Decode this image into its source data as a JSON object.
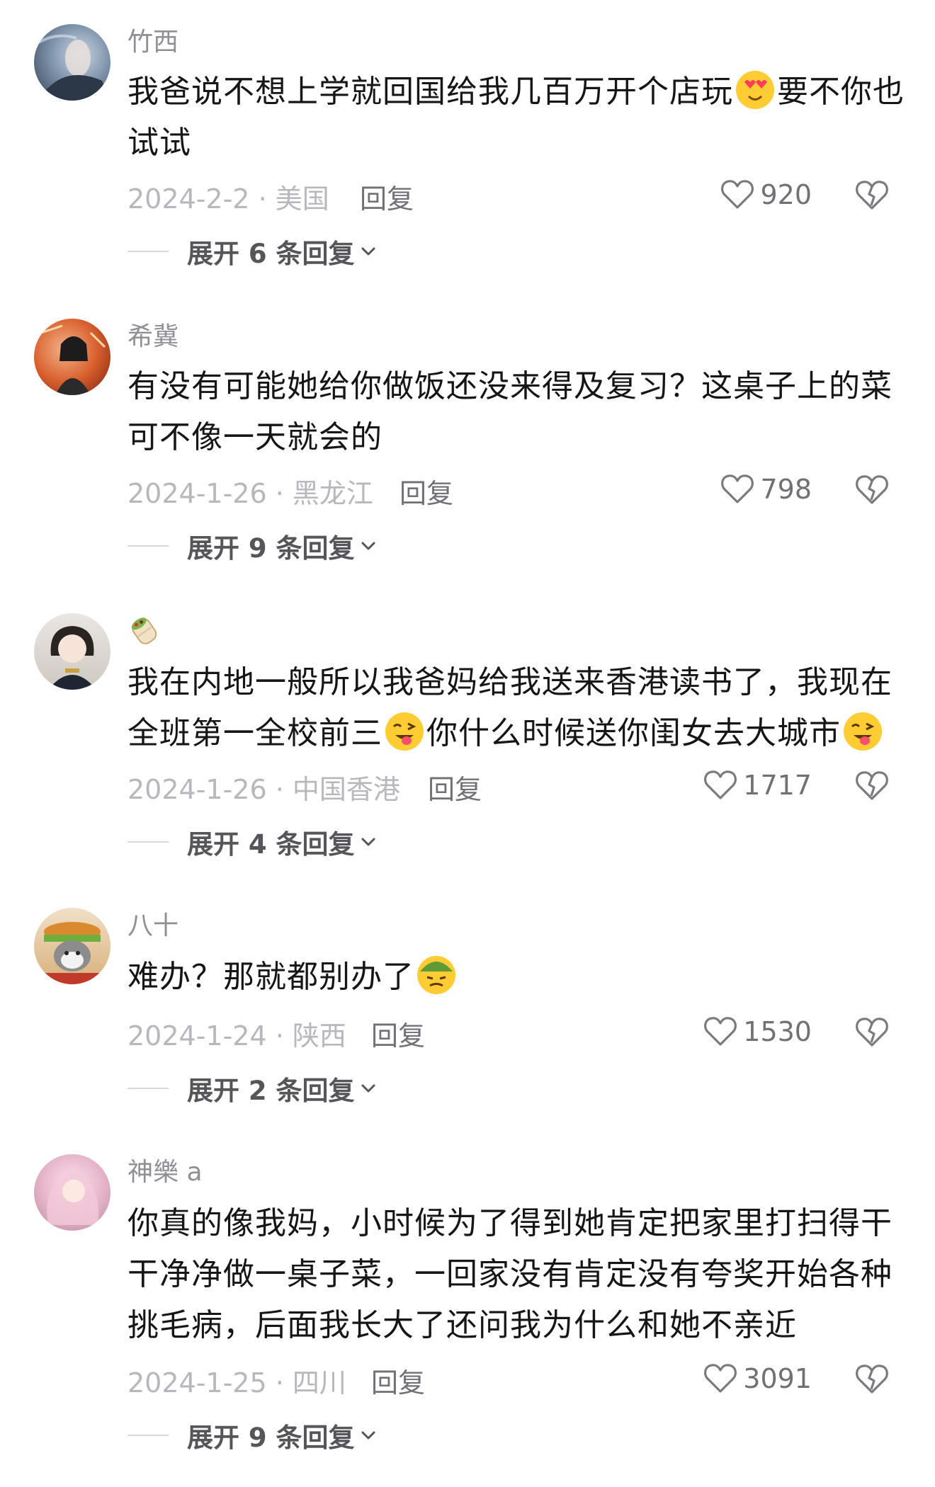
{
  "comments": [
    {
      "username": "竹西",
      "lines": [
        "我爸说不想上学就回国给我几百万开个店玩",
        "要不你也",
        "试试"
      ],
      "date": "2024-2-2",
      "location": "美国",
      "reply": "回复",
      "likes": "920",
      "expand": "展开 6 条回复"
    },
    {
      "username": "希冀",
      "lines": [
        "有没有可能她给你做饭还没来得及复习？这桌子上的菜",
        "可不像一天就会的"
      ],
      "date": "2024-1-26",
      "location": "黑龙江",
      "reply": "回复",
      "likes": "798",
      "expand": "展开 9 条回复"
    },
    {
      "username": "",
      "lines": [
        "我在内地一般所以我爸妈给我送来香港读书了，我现在",
        "全班第一全校前三",
        "你什么时候送你闺女去大城市"
      ],
      "date": "2024-1-26",
      "location": "中国香港",
      "reply": "回复",
      "likes": "1717",
      "expand": "展开 4 条回复"
    },
    {
      "username": "八十",
      "lines": [
        "难办？那就都别办了"
      ],
      "date": "2024-1-24",
      "location": "陕西",
      "reply": "回复",
      "likes": "1530",
      "expand": "展开 2 条回复"
    },
    {
      "username": "神樂 a",
      "lines": [
        "你真的像我妈，小时候为了得到她肯定把家里打扫得干",
        "干净净做一桌子菜，一回家没有肯定没有夸奖开始各种",
        "挑毛病，后面我长大了还问我为什么和她不亲近"
      ],
      "date": "2024-1-25",
      "location": "四川",
      "reply": "回复",
      "likes": "3091",
      "expand": "展开 9 条回复"
    }
  ],
  "icons": {
    "like": "heart-outline-icon",
    "dislike": "broken-heart-icon",
    "expand": "chevron-down-icon",
    "emoji_love": "heart-eyes-emoji",
    "emoji_wink": "winking-tongue-emoji",
    "emoji_salute": "helmet-salute-emoji",
    "username_emoji": "burrito-emoji"
  }
}
